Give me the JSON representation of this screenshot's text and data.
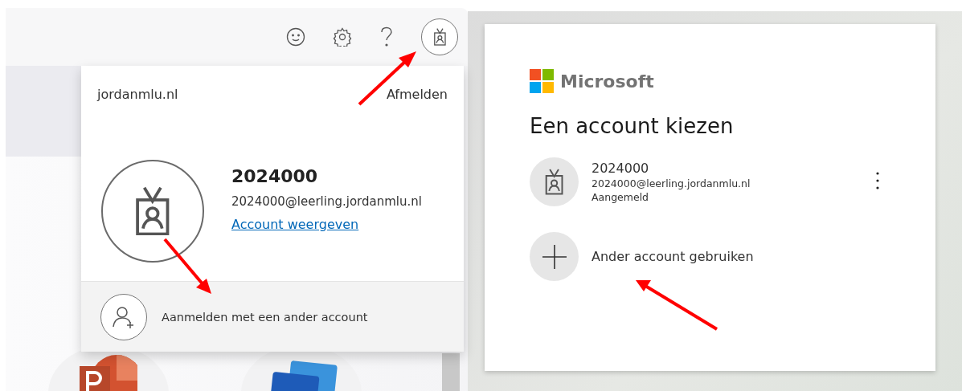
{
  "account_menu": {
    "organization": "jordanmlu.nl",
    "sign_out": "Afmelden",
    "name": "2024000",
    "email": "2024000@leerling.jordanmlu.nl",
    "view_account": "Account weergeven",
    "other_account": "Aanmelden met een ander account"
  },
  "account_picker": {
    "logo_text": "Microsoft",
    "title": "Een account kiezen",
    "accounts": [
      {
        "name": "2024000",
        "email": "2024000@leerling.jordanmlu.nl",
        "status": "Aangemeld"
      }
    ],
    "other_account": "Ander account gebruiken"
  }
}
